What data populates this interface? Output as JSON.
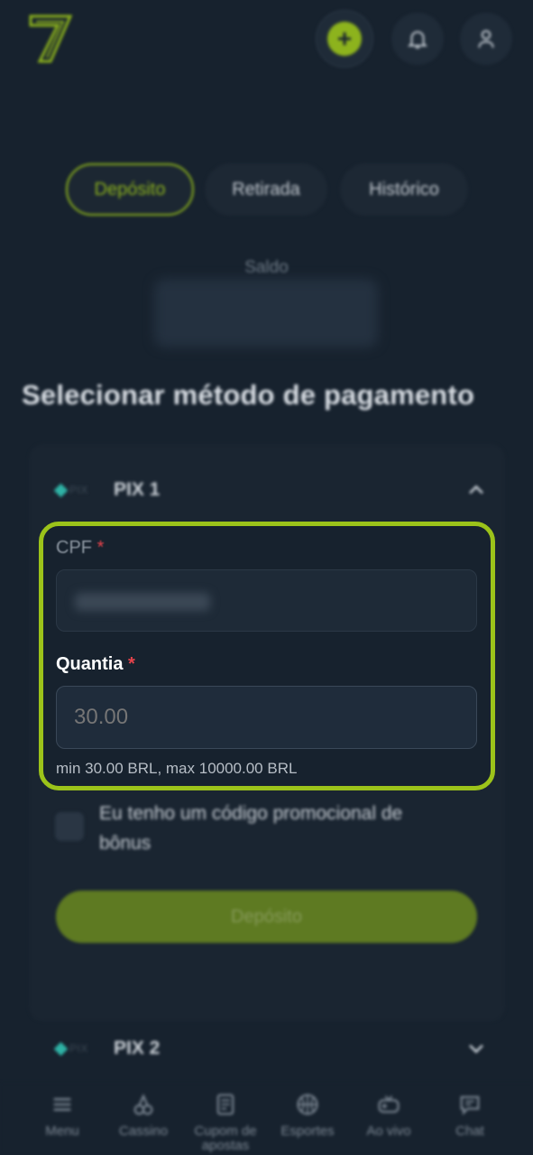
{
  "header": {
    "logo_icon": "brand-7-logo",
    "add_icon": "plus-icon",
    "bell_icon": "bell-icon",
    "user_icon": "user-icon",
    "accent_color": "#8db31d"
  },
  "tabs": [
    {
      "label": "Depósito",
      "active": true
    },
    {
      "label": "Retirada",
      "active": false
    },
    {
      "label": "Histórico",
      "active": false
    }
  ],
  "balance": {
    "label": "Saldo"
  },
  "section_title": "Selecionar método de pagamento",
  "methods": [
    {
      "name": "PIX 1",
      "logo_text": "PIX",
      "expanded": true
    },
    {
      "name": "PIX 2",
      "logo_text": "PIX",
      "expanded": false
    }
  ],
  "form": {
    "cpf_label": "CPF",
    "required_mark": "*",
    "amount_label": "Quantia",
    "amount_placeholder": "30.00",
    "limits": "min 30.00 BRL, max 10000.00 BRL",
    "promo_checkbox_label": "Eu tenho um código promocional de bônus",
    "submit_label": "Depósito",
    "highlight_color": "#9cc31a"
  },
  "bottom_nav": [
    {
      "label": "Menu",
      "icon": "menu-icon"
    },
    {
      "label": "Cassino",
      "icon": "cherries-icon"
    },
    {
      "label": "Cupom de apostas",
      "icon": "receipt-icon"
    },
    {
      "label": "Esportes",
      "icon": "basketball-icon"
    },
    {
      "label": "Ao vivo",
      "icon": "gamepad-icon"
    },
    {
      "label": "Chat",
      "icon": "chat-icon"
    }
  ]
}
